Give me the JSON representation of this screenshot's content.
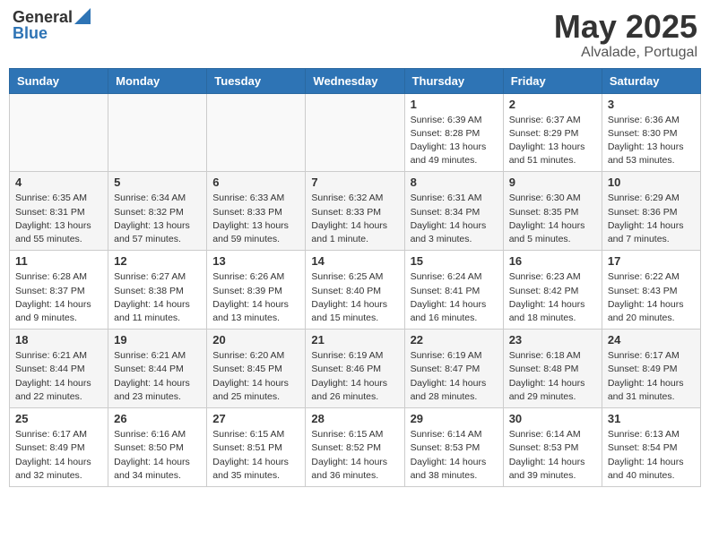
{
  "logo": {
    "general": "General",
    "blue": "Blue"
  },
  "title": {
    "month": "May 2025",
    "location": "Alvalade, Portugal"
  },
  "headers": [
    "Sunday",
    "Monday",
    "Tuesday",
    "Wednesday",
    "Thursday",
    "Friday",
    "Saturday"
  ],
  "weeks": [
    [
      {
        "day": "",
        "info": ""
      },
      {
        "day": "",
        "info": ""
      },
      {
        "day": "",
        "info": ""
      },
      {
        "day": "",
        "info": ""
      },
      {
        "day": "1",
        "info": "Sunrise: 6:39 AM\nSunset: 8:28 PM\nDaylight: 13 hours\nand 49 minutes."
      },
      {
        "day": "2",
        "info": "Sunrise: 6:37 AM\nSunset: 8:29 PM\nDaylight: 13 hours\nand 51 minutes."
      },
      {
        "day": "3",
        "info": "Sunrise: 6:36 AM\nSunset: 8:30 PM\nDaylight: 13 hours\nand 53 minutes."
      }
    ],
    [
      {
        "day": "4",
        "info": "Sunrise: 6:35 AM\nSunset: 8:31 PM\nDaylight: 13 hours\nand 55 minutes."
      },
      {
        "day": "5",
        "info": "Sunrise: 6:34 AM\nSunset: 8:32 PM\nDaylight: 13 hours\nand 57 minutes."
      },
      {
        "day": "6",
        "info": "Sunrise: 6:33 AM\nSunset: 8:33 PM\nDaylight: 13 hours\nand 59 minutes."
      },
      {
        "day": "7",
        "info": "Sunrise: 6:32 AM\nSunset: 8:33 PM\nDaylight: 14 hours\nand 1 minute."
      },
      {
        "day": "8",
        "info": "Sunrise: 6:31 AM\nSunset: 8:34 PM\nDaylight: 14 hours\nand 3 minutes."
      },
      {
        "day": "9",
        "info": "Sunrise: 6:30 AM\nSunset: 8:35 PM\nDaylight: 14 hours\nand 5 minutes."
      },
      {
        "day": "10",
        "info": "Sunrise: 6:29 AM\nSunset: 8:36 PM\nDaylight: 14 hours\nand 7 minutes."
      }
    ],
    [
      {
        "day": "11",
        "info": "Sunrise: 6:28 AM\nSunset: 8:37 PM\nDaylight: 14 hours\nand 9 minutes."
      },
      {
        "day": "12",
        "info": "Sunrise: 6:27 AM\nSunset: 8:38 PM\nDaylight: 14 hours\nand 11 minutes."
      },
      {
        "day": "13",
        "info": "Sunrise: 6:26 AM\nSunset: 8:39 PM\nDaylight: 14 hours\nand 13 minutes."
      },
      {
        "day": "14",
        "info": "Sunrise: 6:25 AM\nSunset: 8:40 PM\nDaylight: 14 hours\nand 15 minutes."
      },
      {
        "day": "15",
        "info": "Sunrise: 6:24 AM\nSunset: 8:41 PM\nDaylight: 14 hours\nand 16 minutes."
      },
      {
        "day": "16",
        "info": "Sunrise: 6:23 AM\nSunset: 8:42 PM\nDaylight: 14 hours\nand 18 minutes."
      },
      {
        "day": "17",
        "info": "Sunrise: 6:22 AM\nSunset: 8:43 PM\nDaylight: 14 hours\nand 20 minutes."
      }
    ],
    [
      {
        "day": "18",
        "info": "Sunrise: 6:21 AM\nSunset: 8:44 PM\nDaylight: 14 hours\nand 22 minutes."
      },
      {
        "day": "19",
        "info": "Sunrise: 6:21 AM\nSunset: 8:44 PM\nDaylight: 14 hours\nand 23 minutes."
      },
      {
        "day": "20",
        "info": "Sunrise: 6:20 AM\nSunset: 8:45 PM\nDaylight: 14 hours\nand 25 minutes."
      },
      {
        "day": "21",
        "info": "Sunrise: 6:19 AM\nSunset: 8:46 PM\nDaylight: 14 hours\nand 26 minutes."
      },
      {
        "day": "22",
        "info": "Sunrise: 6:19 AM\nSunset: 8:47 PM\nDaylight: 14 hours\nand 28 minutes."
      },
      {
        "day": "23",
        "info": "Sunrise: 6:18 AM\nSunset: 8:48 PM\nDaylight: 14 hours\nand 29 minutes."
      },
      {
        "day": "24",
        "info": "Sunrise: 6:17 AM\nSunset: 8:49 PM\nDaylight: 14 hours\nand 31 minutes."
      }
    ],
    [
      {
        "day": "25",
        "info": "Sunrise: 6:17 AM\nSunset: 8:49 PM\nDaylight: 14 hours\nand 32 minutes."
      },
      {
        "day": "26",
        "info": "Sunrise: 6:16 AM\nSunset: 8:50 PM\nDaylight: 14 hours\nand 34 minutes."
      },
      {
        "day": "27",
        "info": "Sunrise: 6:15 AM\nSunset: 8:51 PM\nDaylight: 14 hours\nand 35 minutes."
      },
      {
        "day": "28",
        "info": "Sunrise: 6:15 AM\nSunset: 8:52 PM\nDaylight: 14 hours\nand 36 minutes."
      },
      {
        "day": "29",
        "info": "Sunrise: 6:14 AM\nSunset: 8:53 PM\nDaylight: 14 hours\nand 38 minutes."
      },
      {
        "day": "30",
        "info": "Sunrise: 6:14 AM\nSunset: 8:53 PM\nDaylight: 14 hours\nand 39 minutes."
      },
      {
        "day": "31",
        "info": "Sunrise: 6:13 AM\nSunset: 8:54 PM\nDaylight: 14 hours\nand 40 minutes."
      }
    ]
  ]
}
